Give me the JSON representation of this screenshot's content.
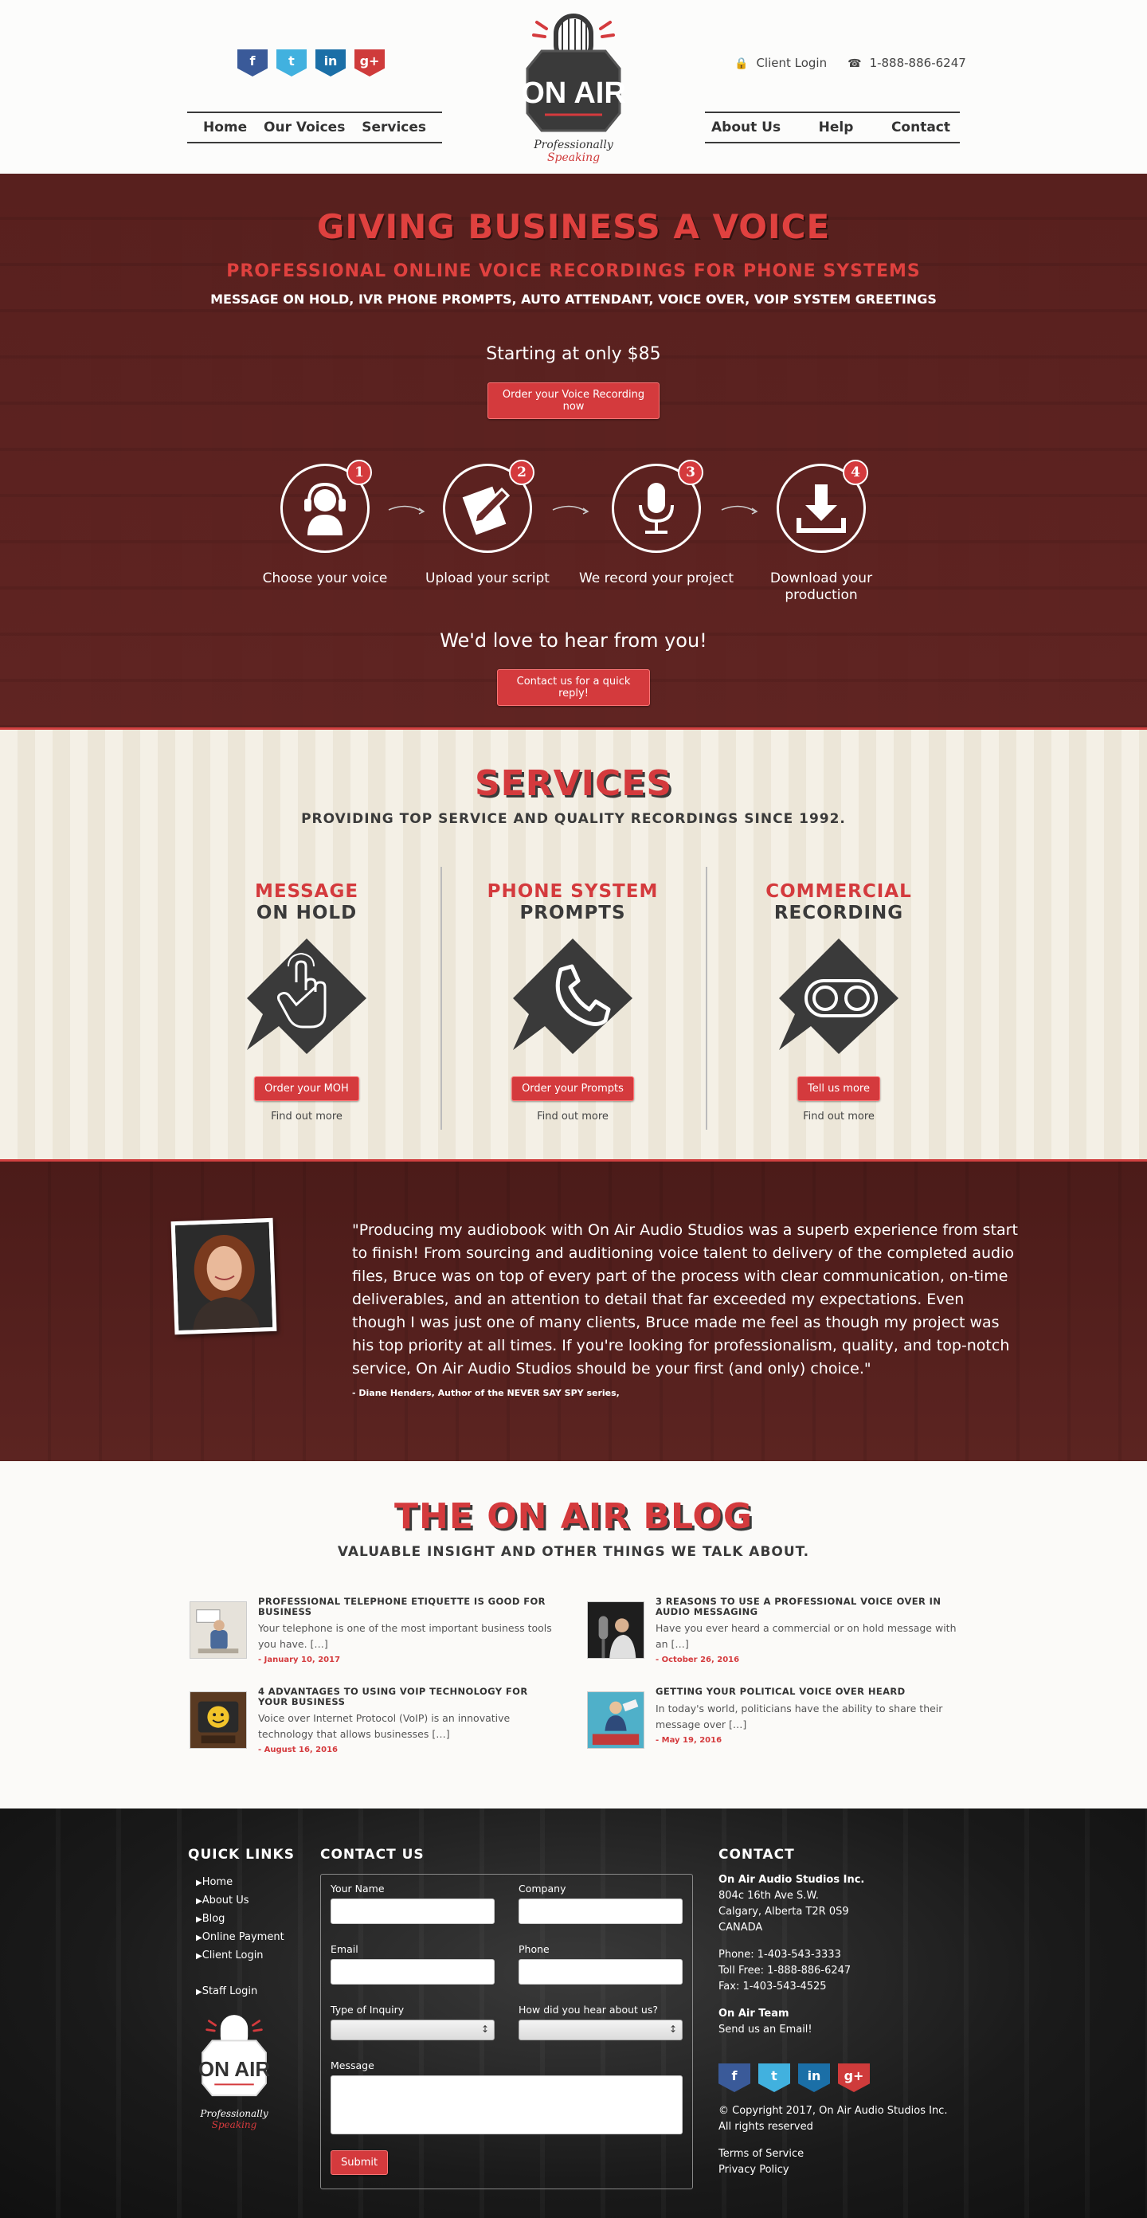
{
  "header": {
    "social": [
      "f",
      "t",
      "in",
      "g+"
    ],
    "nav_left": [
      "Home",
      "Our Voices",
      "Services"
    ],
    "nav_right": [
      "About Us",
      "Help",
      "Contact"
    ],
    "client_login": "Client Login",
    "phone": "1-888-886-6247",
    "logo_text": "ON AIR",
    "logo_tagline_1": "Professionally",
    "logo_tagline_2": "Speaking"
  },
  "hero": {
    "title": "GIVING BUSINESS A VOICE",
    "subtitle": "PROFESSIONAL ONLINE VOICE RECORDINGS FOR PHONE SYSTEMS",
    "subtitle2": "MESSAGE ON HOLD, IVR PHONE PROMPTS, AUTO ATTENDANT, VOICE OVER, VOIP SYSTEM GREETINGS",
    "price": "Starting at only $85",
    "order_button": "Order your Voice Recording now",
    "steps": [
      {
        "num": "1",
        "label": "Choose your voice",
        "icon": "headset-person-icon"
      },
      {
        "num": "2",
        "label": "Upload your script",
        "icon": "script-pencil-icon"
      },
      {
        "num": "3",
        "label": "We record your project",
        "icon": "microphone-icon"
      },
      {
        "num": "4",
        "label": "Download your production",
        "icon": "download-icon"
      }
    ],
    "love": "We'd love to hear from you!",
    "contact_button": "Contact us for a quick reply!"
  },
  "services": {
    "title": "SERVICES",
    "subtitle": "PROVIDING TOP SERVICE AND QUALITY RECORDINGS SINCE 1992.",
    "items": [
      {
        "t1": "MESSAGE",
        "t2": "ON HOLD",
        "button": "Order your MOH",
        "find": "Find out more",
        "icon": "hand-pointer-icon"
      },
      {
        "t1": "PHONE SYSTEM",
        "t2": "PROMPTS",
        "button": "Order your Prompts",
        "find": "Find out more",
        "icon": "phone-handset-icon"
      },
      {
        "t1": "COMMERCIAL",
        "t2": "RECORDING",
        "button": "Tell us more",
        "find": "Find out more",
        "icon": "tape-reel-icon"
      }
    ]
  },
  "testimonial": {
    "quote": "\"Producing my audiobook with On Air Audio Studios was a superb experience from start to finish! From sourcing and auditioning voice talent to delivery of the completed audio files, Bruce was on top of every part of the process with clear communication, on-time deliverables, and an attention to detail that far exceeded my expectations. Even though I was just one of many clients, Bruce made me feel as though my project was his top priority at all times. If you're looking for professionalism, quality, and top-notch service, On Air Audio Studios should be your first (and only) choice.\"",
    "author": "- Diane Henders, Author of the NEVER SAY SPY series,"
  },
  "blog": {
    "title": "THE ON AIR BLOG",
    "subtitle": "VALUABLE INSIGHT AND OTHER THINGS WE TALK ABOUT.",
    "posts": [
      {
        "title": "PROFESSIONAL TELEPHONE ETIQUETTE IS GOOD FOR BUSINESS",
        "excerpt": "Your telephone is one of the most important business tools you have. […]",
        "date": "- January 10, 2017"
      },
      {
        "title": "3 REASONS TO USE A PROFESSIONAL VOICE OVER IN AUDIO MESSAGING",
        "excerpt": "Have you ever heard a commercial or on hold message with an […]",
        "date": "- October 26, 2016"
      },
      {
        "title": "4 ADVANTAGES TO USING VOIP TECHNOLOGY FOR YOUR BUSINESS",
        "excerpt": "Voice over Internet Protocol (VoIP) is an innovative technology that allows businesses […]",
        "date": "- August 16, 2016"
      },
      {
        "title": "GETTING YOUR POLITICAL VOICE OVER HEARD",
        "excerpt": "In today's world, politicians have the ability to share their message over […]",
        "date": "- May 19, 2016"
      }
    ]
  },
  "footer": {
    "quick_links_title": "QUICK LINKS",
    "quick_links": [
      "Home",
      "About Us",
      "Blog",
      "Online Payment",
      "Client Login"
    ],
    "staff_login": "Staff Login",
    "contact_form_title": "CONTACT US",
    "form": {
      "name": "Your Name",
      "company": "Company",
      "email": "Email",
      "phone": "Phone",
      "inquiry": "Type of Inquiry",
      "heard": "How did you hear about us?",
      "message": "Message",
      "submit": "Submit"
    },
    "contact_title": "CONTACT",
    "company": "On Air Audio Studios Inc.",
    "address1": "804c 16th Ave S.W.",
    "address2": "Calgary, Alberta T2R 0S9",
    "country": "CANADA",
    "phone": "Phone: 1-403-543-3333",
    "tollfree": "Toll Free: 1-888-886-6247",
    "fax": "Fax: 1-403-543-4525",
    "team": "On Air Team",
    "email_link": "Send us an Email!",
    "copyright": "© Copyright 2017, On Air Audio Studios Inc.",
    "rights": "All rights reserved",
    "terms": "Terms of Service",
    "privacy": "Privacy Policy"
  },
  "colors": {
    "accent": "#d43a3d",
    "hero_bg": "#5a2422",
    "services_bg": "#f4f0e6",
    "footer_bg": "#1a1a1a"
  }
}
